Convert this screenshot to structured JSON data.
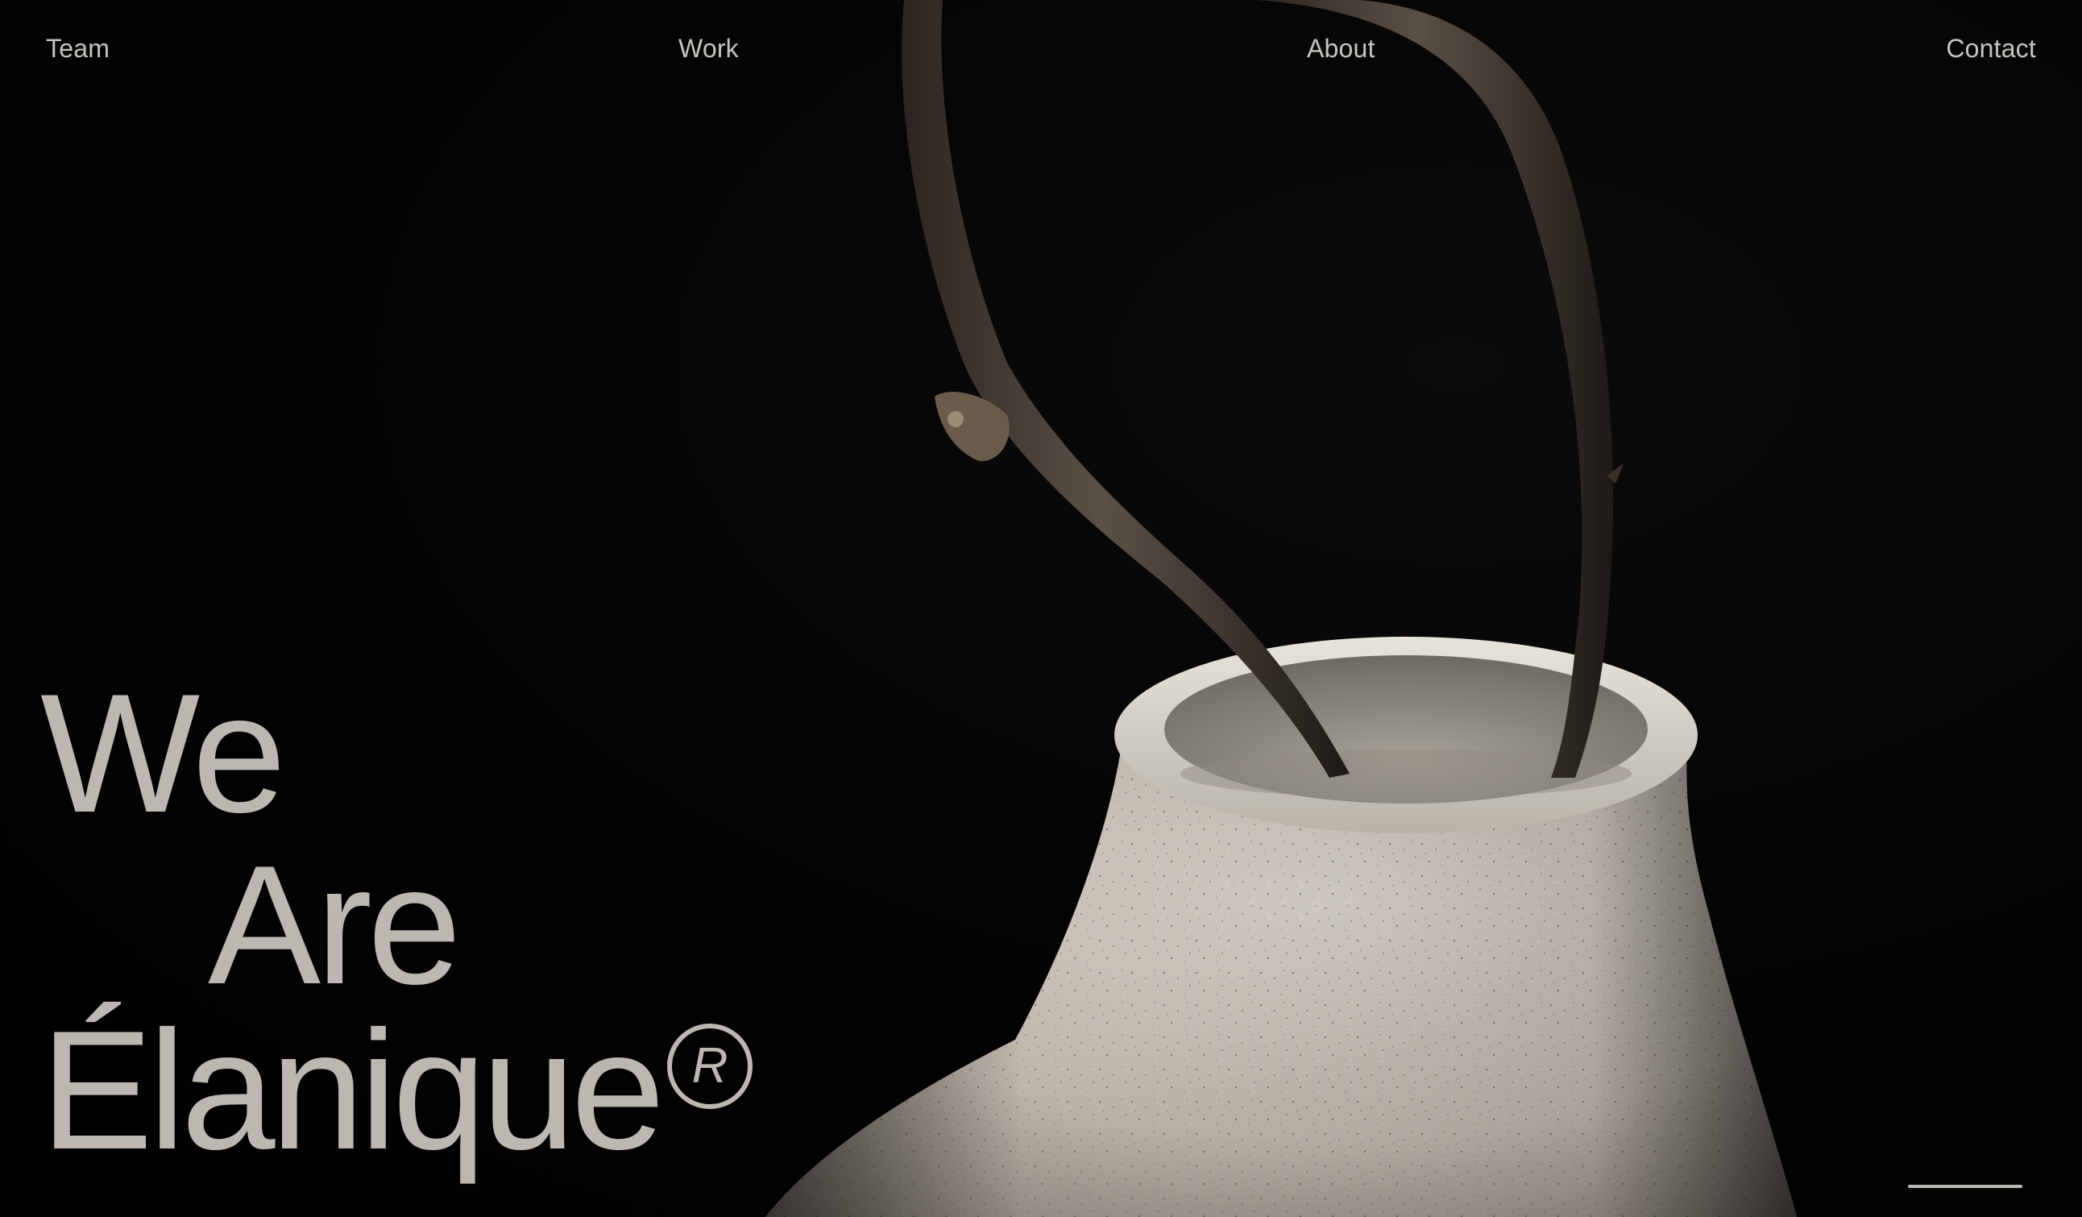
{
  "nav": {
    "team": "Team",
    "work": "Work",
    "about": "About",
    "contact": "Contact"
  },
  "hero": {
    "line1": "We",
    "line2": "Are",
    "line3": "Élanique",
    "registered_mark": "R"
  },
  "colors": {
    "background": "#000000",
    "text": "#bcb8b1",
    "nav_text": "#c7c4bd",
    "vase": "#cfc8be",
    "branch": "#4a4036"
  }
}
